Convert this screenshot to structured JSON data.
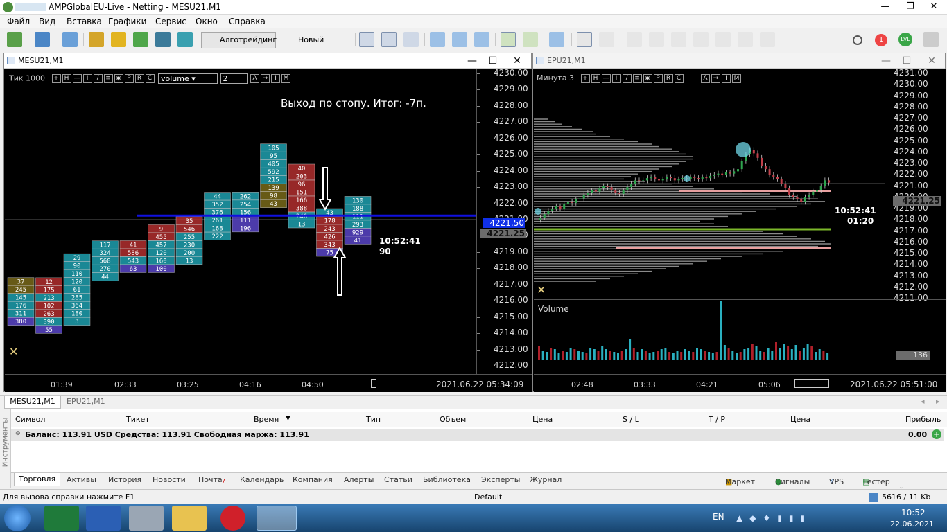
{
  "app": {
    "title": "AMPGlobalEU-Live - Netting - MESU21,M1",
    "window_controls": [
      "—",
      "❐",
      "✕"
    ]
  },
  "menu": [
    "Файл",
    "Вид",
    "Вставка",
    "Графики",
    "Сервис",
    "Окно",
    "Справка"
  ],
  "toolbar": {
    "algo_label": "Алготрейдинг",
    "new_order_label": "Новый ордер",
    "notify_count": "1",
    "lvl_label": "LVL"
  },
  "left_chart": {
    "title": "MESU21,M1",
    "period_label": "Тик 1000",
    "tools": [
      "+",
      "H",
      "—",
      "I",
      "/",
      "≡",
      "◉",
      "P",
      "R",
      "C"
    ],
    "indicator_select": "volume",
    "spin_value": "2",
    "tools2": [
      "A",
      "→",
      "I",
      "M"
    ],
    "annotation": "Выход по стопу. Итог: -7п.",
    "price_axis": [
      "4230.00",
      "4229.00",
      "4228.00",
      "4227.00",
      "4226.00",
      "4225.00",
      "4224.00",
      "4223.00",
      "4222.00",
      "4221.00",
      "4220.00",
      "4219.00",
      "4218.00",
      "4217.00",
      "4216.00",
      "4215.00",
      "4214.00",
      "4213.00",
      "4212.00"
    ],
    "price_axis_min": 4212.0,
    "price_axis_max": 4230.0,
    "level_line_price": 4221.5,
    "bid_label": "4221.50",
    "last_label": "4221.25",
    "timer": "10:52:41",
    "ticks_left": "90",
    "time_axis": [
      "01:39",
      "02:33",
      "03:25",
      "04:16",
      "04:50"
    ],
    "date_label": "2021.06.22 05:34:09",
    "columns": [
      {
        "bottom": 4215.0,
        "colors": [
          "#7a6a1a",
          "#7a6a1a",
          "#1fa0b0",
          "#1fa0b0",
          "#1fa0b0",
          "#5a46c8"
        ],
        "values": [
          "37",
          "245",
          "145",
          "176",
          "311",
          "380"
        ]
      },
      {
        "bottom": 4214.5,
        "colors": [
          "#b23030",
          "#b23030",
          "#1fa0b0",
          "#b23030",
          "#b23030",
          "#1fa0b0",
          "#5a46c8"
        ],
        "values": [
          "12",
          "175",
          "213",
          "102",
          "263",
          "390",
          "55"
        ]
      },
      {
        "bottom": 4215.0,
        "colors": [
          "#1fa0b0",
          "#1fa0b0",
          "#1fa0b0",
          "#1fa0b0",
          "#1fa0b0",
          "#1fa0b0",
          "#1fa0b0",
          "#1fa0b0",
          "#1fa0b0"
        ],
        "values": [
          "29",
          "90",
          "110",
          "120",
          "61",
          "285",
          "364",
          "180",
          "3"
        ]
      },
      {
        "bottom": 4217.75,
        "colors": [
          "#1fa0b0",
          "#1fa0b0",
          "#1fa0b0",
          "#1fa0b0",
          "#1fa0b0"
        ],
        "values": [
          "117",
          "324",
          "568",
          "270",
          "44"
        ]
      },
      {
        "bottom": 4218.25,
        "colors": [
          "#b23030",
          "#b23030",
          "#1fa0b0",
          "#5a46c8"
        ],
        "values": [
          "41",
          "586",
          "543",
          "63"
        ]
      },
      {
        "bottom": 4218.25,
        "colors": [
          "#b23030",
          "#b23030",
          "#1fa0b0",
          "#1fa0b0",
          "#1fa0b0",
          "#5a46c8"
        ],
        "values": [
          "9",
          "455",
          "457",
          "120",
          "160",
          "100"
        ]
      },
      {
        "bottom": 4218.75,
        "colors": [
          "#b23030",
          "#b23030",
          "#1fa0b0",
          "#1fa0b0",
          "#1fa0b0",
          "#1fa0b0"
        ],
        "values": [
          "35",
          "546",
          "255",
          "230",
          "200",
          "13"
        ]
      },
      {
        "bottom": 4220.25,
        "colors": [
          "#1fa0b0",
          "#1fa0b0",
          "#1fa0b0",
          "#1fa0b0",
          "#1fa0b0",
          "#1fa0b0"
        ],
        "values": [
          "44",
          "352",
          "376",
          "261",
          "168",
          "222"
        ]
      },
      {
        "bottom": 4220.75,
        "colors": [
          "#1fa0b0",
          "#1fa0b0",
          "#1fa0b0",
          "#5a46c8",
          "#5a46c8"
        ],
        "values": [
          "262",
          "254",
          "156",
          "111",
          "196"
        ]
      },
      {
        "bottom": 4222.25,
        "colors": [
          "#1fa0b0",
          "#1fa0b0",
          "#1fa0b0",
          "#1fa0b0",
          "#1fa0b0",
          "#7a6a1a",
          "#7a6a1a"
        ],
        "values": [
          "105",
          "95",
          "405",
          "592",
          "215",
          "139",
          "98",
          "43"
        ]
      },
      {
        "bottom": 4221.0,
        "colors": [
          "#b23030",
          "#b23030",
          "#b23030",
          "#b23030",
          "#b23030",
          "#b23030",
          "#1fa0b0",
          "#1fa0b0"
        ],
        "values": [
          "40",
          "203",
          "96",
          "151",
          "166",
          "388",
          "246",
          "13"
        ]
      },
      {
        "bottom": 4219.25,
        "colors": [
          "#1fa0b0",
          "#b23030",
          "#b23030",
          "#b23030",
          "#b23030",
          "#5a46c8"
        ],
        "values": [
          "43",
          "178",
          "243",
          "426",
          "343",
          "75"
        ]
      },
      {
        "bottom": 4220.0,
        "colors": [
          "#1fa0b0",
          "#1fa0b0",
          "#1fa0b0",
          "#1fa0b0",
          "#5a46c8"
        ],
        "values": [
          "130",
          "188",
          "111",
          "293",
          "929",
          "41"
        ]
      }
    ]
  },
  "right_chart": {
    "title": "EPU21,M1",
    "period_label": "Минута 3",
    "tools": [
      "+",
      "H",
      "—",
      "I",
      "/",
      "≡",
      "◉",
      "P",
      "R",
      "C"
    ],
    "tools2": [
      "A",
      "→",
      "I",
      "M"
    ],
    "price_axis": [
      "4231.00",
      "4230.00",
      "4229.00",
      "4228.00",
      "4227.00",
      "4226.00",
      "4225.00",
      "4224.00",
      "4223.00",
      "4222.00",
      "4221.00",
      "4220.00",
      "4219.00",
      "4218.00",
      "4217.00",
      "4216.00",
      "4215.00",
      "4214.00",
      "4213.00",
      "4212.00",
      "4211.00"
    ],
    "price_axis_min": 4211.0,
    "price_axis_max": 4231.0,
    "last_label": "4221.25",
    "timer": "10:52:41",
    "timer2": "01:20",
    "volume_label": "Volume",
    "volume_value": "136",
    "time_axis": [
      "02:48",
      "03:33",
      "04:21",
      "05:06"
    ],
    "date_label": "2021.06.22 05:51:00"
  },
  "chart_tabs": [
    "MESU21,M1",
    "EPU21,M1"
  ],
  "terminal": {
    "side_label": "Инструменты",
    "columns": [
      "Символ",
      "Тикет",
      "Время",
      "Тип",
      "Объем",
      "Цена",
      "S / L",
      "T / P",
      "Цена",
      "Прибыль"
    ],
    "balance_text": "Баланс: 113.91 USD  Средства: 113.91  Свободная маржа: 113.91",
    "balance_profit": "0.00",
    "tabs": [
      "Торговля",
      "Активы",
      "История",
      "Новости",
      "Почта",
      "Календарь",
      "Компания",
      "Алерты",
      "Статьи",
      "Библиотека",
      "Эксперты",
      "Журнал"
    ],
    "mail_badge": "7",
    "right_tabs": [
      "Маркет",
      "Сигналы",
      "VPS",
      "Тестер стратегий"
    ]
  },
  "statusbar": {
    "help": "Для вызова справки нажмите F1",
    "profile": "Default",
    "traffic": "5616 / 11 Kb"
  },
  "taskbar": {
    "lang": "EN",
    "time": "10:52",
    "date": "22.06.2021"
  },
  "colors": {
    "bull": "#1fa0b0",
    "bear": "#b23030",
    "level_line": "#1010e0",
    "grid_text": "#d8d8d8"
  }
}
